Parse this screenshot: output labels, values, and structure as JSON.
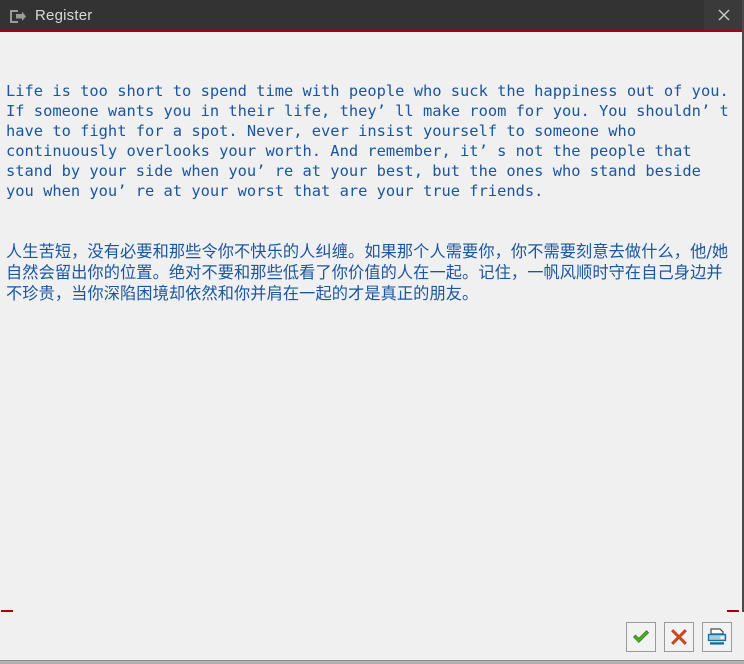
{
  "window": {
    "title": "Register",
    "title_icon": "enter-arrow-icon",
    "close_icon": "close-icon",
    "accent_color": "#aa0000",
    "titlebar_bg": "#333333",
    "body_bg": "#f0f0f0"
  },
  "content": {
    "text_color": "#1a56a0",
    "paragraph_en": "Life is too short to spend time with people who suck the happiness out of you. If someone wants you in their life, they’ ll make room for you. You shouldn’ t have to fight for a spot. Never, ever insist yourself to someone who continuously overlooks your worth. And remember, it’ s not the people that stand by your side when you’ re at your best, but the ones who stand beside you when you’ re at your worst that are your true friends.",
    "paragraph_cn": "人生苦短，没有必要和那些令你不快乐的人纠缠。如果那个人需要你，你不需要刻意去做什么，他/她自然会留出你的位置。绝对不要和那些低看了你价值的人在一起。记住，一帆风顺时守在自己身边并不珍贵，当你深陷困境却依然和你并肩在一起的才是真正的朋友。"
  },
  "toolbar": {
    "ok_label": "",
    "cancel_label": "",
    "print_label": "",
    "ok_icon": "checkmark-icon",
    "cancel_icon": "cross-icon",
    "print_icon": "printer-icon",
    "ok_color": "#4caf22",
    "cancel_color": "#d94a1e",
    "print_color": "#1a6fa0"
  }
}
